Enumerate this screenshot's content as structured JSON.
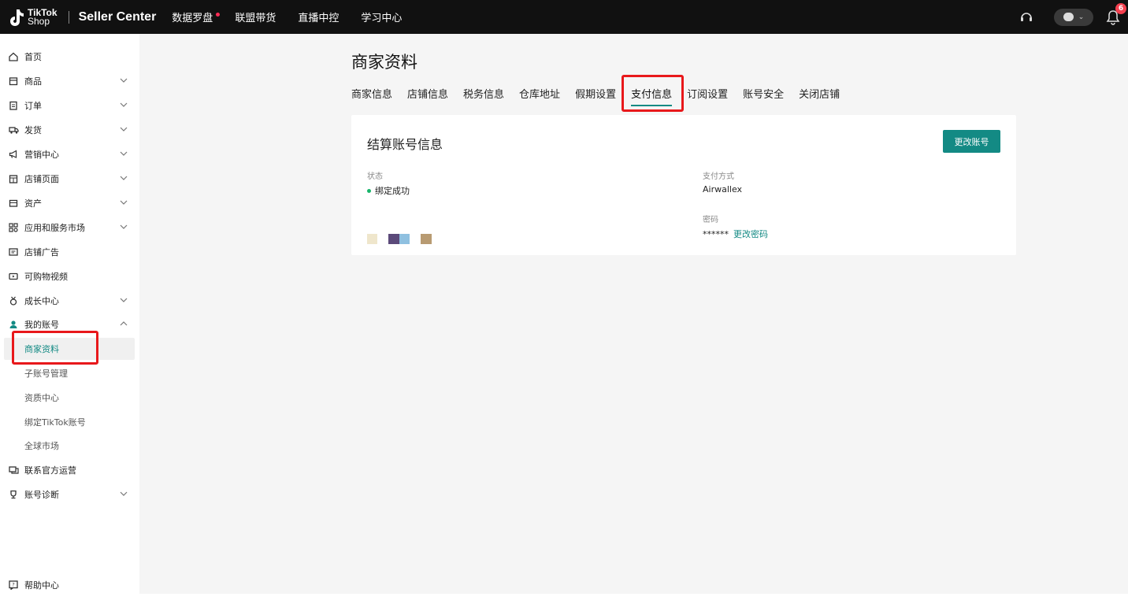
{
  "header": {
    "logo_line1": "TikTok",
    "logo_line2": "Shop",
    "app_name": "Seller Center",
    "nav": [
      "数据罗盘",
      "联盟带货",
      "直播中控",
      "学习中心"
    ],
    "notification_count": "6",
    "accent_dot_color": "#fe2c55"
  },
  "sidebar": {
    "items": [
      {
        "label": "首页",
        "icon": "home-icon",
        "expandable": false
      },
      {
        "label": "商品",
        "icon": "product-icon",
        "expandable": true
      },
      {
        "label": "订单",
        "icon": "order-icon",
        "expandable": true
      },
      {
        "label": "发货",
        "icon": "truck-icon",
        "expandable": true
      },
      {
        "label": "营销中心",
        "icon": "megaphone-icon",
        "expandable": true
      },
      {
        "label": "店铺页面",
        "icon": "store-icon",
        "expandable": true
      },
      {
        "label": "资产",
        "icon": "wallet-icon",
        "expandable": true
      },
      {
        "label": "应用和服务市场",
        "icon": "apps-icon",
        "expandable": true
      },
      {
        "label": "店铺广告",
        "icon": "ad-icon",
        "expandable": false
      },
      {
        "label": "可购物视频",
        "icon": "video-icon",
        "expandable": false
      },
      {
        "label": "成长中心",
        "icon": "medal-icon",
        "expandable": true
      },
      {
        "label": "我的账号",
        "icon": "user-icon",
        "expandable": true
      }
    ],
    "sub_items": [
      "商家资料",
      "子账号管理",
      "资质中心",
      "绑定TikTok账号",
      "全球市场"
    ],
    "active_sub": "商家资料",
    "after_items": [
      {
        "label": "联系官方运营",
        "icon": "contact-icon",
        "expandable": false
      },
      {
        "label": "账号诊断",
        "icon": "trophy-icon",
        "expandable": true
      }
    ],
    "help": "帮助中心"
  },
  "main": {
    "title": "商家资料",
    "tabs": [
      "商家信息",
      "店铺信息",
      "税务信息",
      "仓库地址",
      "假期设置",
      "支付信息",
      "订阅设置",
      "账号安全",
      "关闭店铺"
    ],
    "active_tab": "支付信息",
    "card": {
      "title": "结算账号信息",
      "change_button": "更改账号",
      "status_label": "状态",
      "status_value": "绑定成功",
      "payment_method_label": "支付方式",
      "payment_method_value": "Airwallex",
      "password_label": "密码",
      "password_value": "******",
      "change_password_link": "更改密码"
    }
  },
  "colors": {
    "accent": "#138a84",
    "highlight": "#e8181b",
    "success": "#18b56b"
  }
}
